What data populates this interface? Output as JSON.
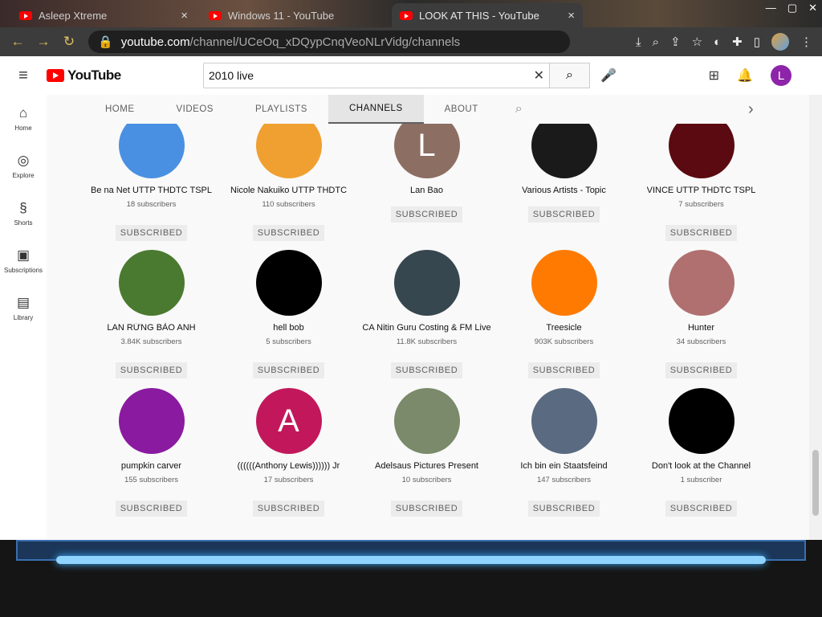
{
  "browser": {
    "tabs": [
      {
        "label": "Asleep Xtreme"
      },
      {
        "label": "Windows 11 - YouTube"
      },
      {
        "label": "LOOK AT THIS - YouTube"
      }
    ],
    "url_host": "youtube.com",
    "url_path": "/channel/UCeOq_xDQypCnqVeoNLrVidg/channels"
  },
  "masthead": {
    "logo": "YouTube",
    "search_value": "2010 live",
    "user_initial": "L"
  },
  "guide": [
    {
      "icon": "⌂",
      "label": "Home"
    },
    {
      "icon": "◎",
      "label": "Explore"
    },
    {
      "icon": "§",
      "label": "Shorts"
    },
    {
      "icon": "▣",
      "label": "Subscriptions"
    },
    {
      "icon": "▤",
      "label": "Library"
    }
  ],
  "channel_tabs": [
    "HOME",
    "VIDEOS",
    "PLAYLISTS",
    "CHANNELS",
    "ABOUT"
  ],
  "button_label": "SUBSCRIBED",
  "channels": [
    {
      "name": "Be na Net UTTP THDTC TSPL",
      "subs": "18 subscribers",
      "color": "#4a90e2"
    },
    {
      "name": "Nicole Nakuiko UTTP THDTC",
      "subs": "110 subscribers",
      "color": "#f0a030"
    },
    {
      "name": "Lan Bao",
      "subs": "",
      "color": "#8d6e63",
      "letter": "L"
    },
    {
      "name": "Various Artists - Topic",
      "subs": "",
      "color": "#1a1a1a"
    },
    {
      "name": "VINCE UTTP THDTC TSPL",
      "subs": "7 subscribers",
      "color": "#5a0a10"
    },
    {
      "name": "LAN RỪNG BẢO ANH",
      "subs": "3.84K subscribers",
      "color": "#4a7a30"
    },
    {
      "name": "hell bob",
      "subs": "5 subscribers",
      "color": "#000000"
    },
    {
      "name": "CA Nitin Guru Costing & FM Live",
      "subs": "11.8K subscribers",
      "color": "#37474f"
    },
    {
      "name": "Treesicle",
      "subs": "903K subscribers",
      "color": "#ff7a00"
    },
    {
      "name": "Hunter",
      "subs": "34 subscribers",
      "color": "#b07070"
    },
    {
      "name": "pumpkin carver",
      "subs": "155 subscribers",
      "color": "#8a1aa0"
    },
    {
      "name": "((((((Anthony Lewis)))))) Jr",
      "subs": "17 subscribers",
      "color": "#c2185b",
      "letter": "A"
    },
    {
      "name": "Adelsaus Pictures Present",
      "subs": "10 subscribers",
      "color": "#7a8a6a"
    },
    {
      "name": "Ich bin ein Staatsfeind",
      "subs": "147 subscribers",
      "color": "#5a6a80"
    },
    {
      "name": "Don't look at the Channel",
      "subs": "1 subscriber",
      "color": "#000000"
    }
  ]
}
